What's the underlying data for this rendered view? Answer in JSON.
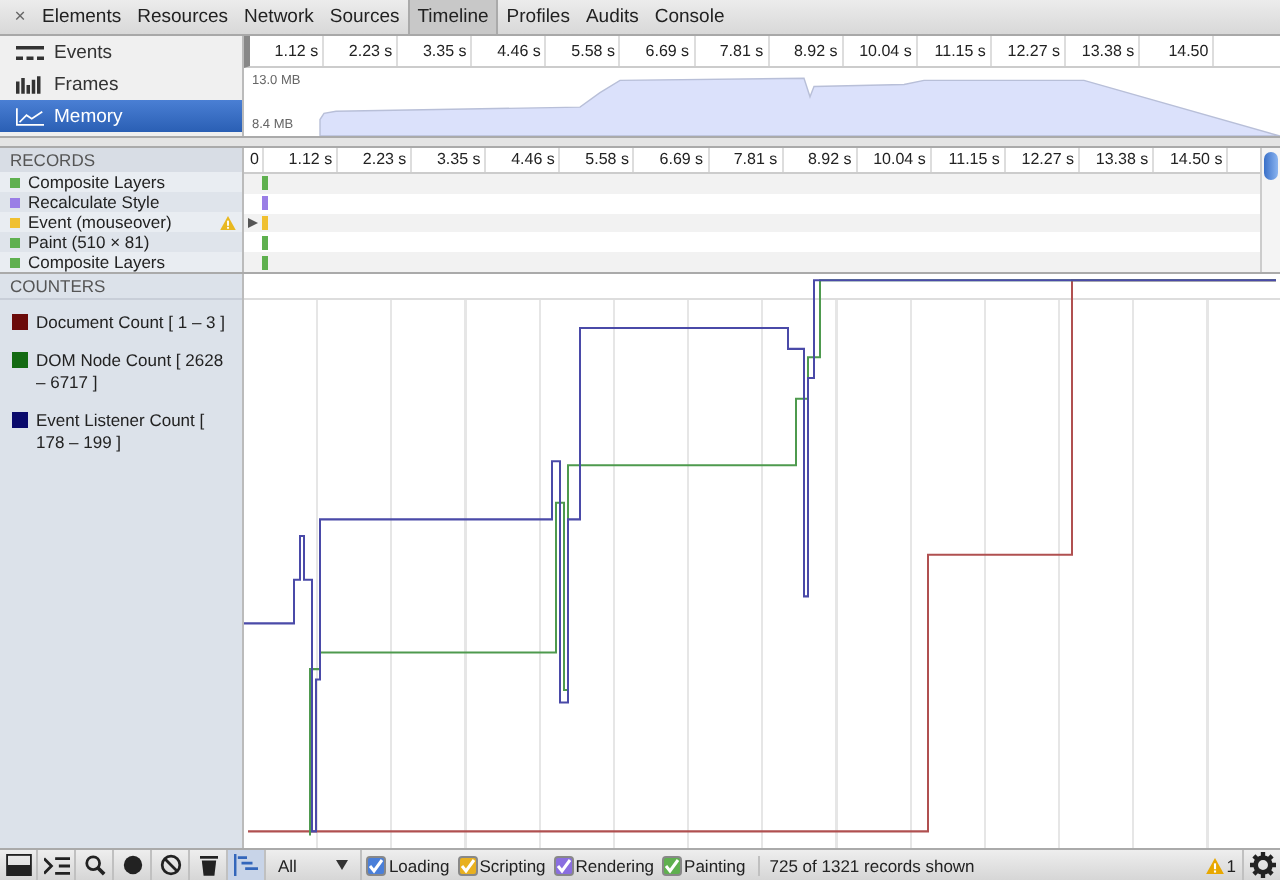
{
  "close_button": "×",
  "tabs": [
    {
      "label": "Elements",
      "selected": false
    },
    {
      "label": "Resources",
      "selected": false
    },
    {
      "label": "Network",
      "selected": false
    },
    {
      "label": "Sources",
      "selected": false
    },
    {
      "label": "Timeline",
      "selected": true
    },
    {
      "label": "Profiles",
      "selected": false
    },
    {
      "label": "Audits",
      "selected": false
    },
    {
      "label": "Console",
      "selected": false
    }
  ],
  "overview_modes": [
    {
      "label": "Events",
      "kind": "events",
      "selected": false
    },
    {
      "label": "Frames",
      "kind": "frames",
      "selected": false
    },
    {
      "label": "Memory",
      "kind": "memory",
      "selected": true
    }
  ],
  "overview_ruler": [
    "1.12 s",
    "2.23 s",
    "3.35 s",
    "4.46 s",
    "5.58 s",
    "6.69 s",
    "7.81 s",
    "8.92 s",
    "10.04 s",
    "11.15 s",
    "12.27 s",
    "13.38 s",
    "14.50"
  ],
  "memory_overview": {
    "max": "13.0 MB",
    "min": "8.4 MB"
  },
  "records_header": "RECORDS",
  "records_ruler": [
    "0",
    "1.12 s",
    "2.23 s",
    "3.35 s",
    "4.46 s",
    "5.58 s",
    "6.69 s",
    "7.81 s",
    "8.92 s",
    "10.04 s",
    "11.15 s",
    "12.27 s",
    "13.38 s",
    "14.50 s"
  ],
  "records": [
    {
      "label": "Composite Layers",
      "color": "#5fb04f",
      "warning": false,
      "expandable": false
    },
    {
      "label": "Recalculate Style",
      "color": "#9a7ee6",
      "warning": false,
      "expandable": false
    },
    {
      "label": "Event (mouseover)",
      "color": "#f0c030",
      "warning": true,
      "expandable": true
    },
    {
      "label": "Paint (510 × 81)",
      "color": "#5fb04f",
      "warning": false,
      "expandable": false
    },
    {
      "label": "Composite Layers",
      "color": "#5fb04f",
      "warning": false,
      "expandable": false
    }
  ],
  "counters_header": "COUNTERS",
  "counters": [
    {
      "label": "Document Count [ 1 – 3 ]",
      "color": "#6b0a0a"
    },
    {
      "label": "DOM Node Count [ 2628 – 6717 ]",
      "color": "#136b13"
    },
    {
      "label": "Event Listener Count [ 178 – 199 ]",
      "color": "#0a0a6b"
    }
  ],
  "filter": {
    "value": "All"
  },
  "categories": [
    {
      "label": "Loading",
      "checked": true,
      "color": "#4a7fd9"
    },
    {
      "label": "Scripting",
      "checked": true,
      "color": "#e8b020"
    },
    {
      "label": "Rendering",
      "checked": true,
      "color": "#8a6ee0"
    },
    {
      "label": "Painting",
      "checked": true,
      "color": "#5fb04f"
    }
  ],
  "status": "725 of 1321 records shown",
  "warning_count": "1"
}
